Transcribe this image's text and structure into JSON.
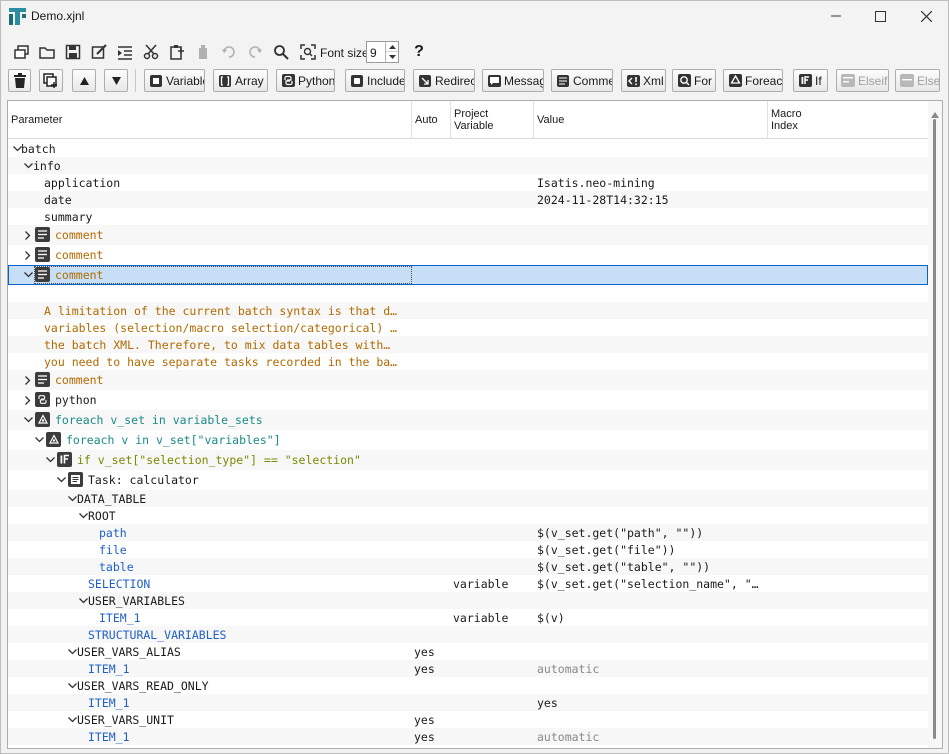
{
  "window": {
    "title": "Demo.xjnl",
    "controls": {
      "minimize": "minimize",
      "maximize": "maximize",
      "close": "close"
    }
  },
  "toolbar_top": {
    "icons": [
      "new-window-icon",
      "open-folder-icon",
      "save-icon",
      "edit-check-icon",
      "indent-icon",
      "cut-icon",
      "paste-insert-icon",
      "clipboard-icon",
      "undo-icon",
      "redo-icon",
      "search-icon",
      "zoom-fit-icon"
    ],
    "font_size_label": "Font size",
    "font_size_value": "9",
    "help_label": "?"
  },
  "toolbar_nodes": {
    "buttons": [
      {
        "label": "Variable",
        "icon": "square-icon"
      },
      {
        "label": "Array",
        "icon": "brackets-icon"
      },
      {
        "label": "Python",
        "icon": "python-icon"
      },
      {
        "label": "Include",
        "icon": "include-icon"
      },
      {
        "label": "Redirect",
        "icon": "redirect-icon"
      },
      {
        "label": "Message",
        "icon": "message-icon"
      },
      {
        "label": "Comment",
        "icon": "comment-icon"
      },
      {
        "label": "Xml",
        "icon": "xml-icon"
      },
      {
        "label": "For",
        "icon": "for-icon"
      },
      {
        "label": "Foreach",
        "icon": "foreach-icon"
      },
      {
        "label": "If",
        "icon": "if-icon"
      },
      {
        "label": "Elseif",
        "icon": "elseif-icon",
        "disabled": true
      },
      {
        "label": "Else",
        "icon": "else-icon",
        "disabled": true
      }
    ]
  },
  "columns": {
    "parameter": "Parameter",
    "auto": "Auto",
    "project_variable_line1": "Project",
    "project_variable_line2": "Variable",
    "value": "Value",
    "macro_index_line1": "Macro",
    "macro_index_line2": "Index"
  },
  "rows": [
    {
      "label": "batch",
      "color": "black",
      "auto": "",
      "pv": "",
      "value": ""
    },
    {
      "label": "info",
      "color": "black",
      "auto": "",
      "pv": "",
      "value": ""
    },
    {
      "label": "application",
      "color": "black",
      "auto": "",
      "pv": "",
      "value": "Isatis.neo-mining"
    },
    {
      "label": "date",
      "color": "black",
      "auto": "",
      "pv": "",
      "value": "2024-11-28T14:32:15"
    },
    {
      "label": "summary",
      "color": "black",
      "auto": "",
      "pv": "",
      "value": ""
    },
    {
      "label": "comment",
      "color": "orange",
      "auto": "",
      "pv": "",
      "value": ""
    },
    {
      "label": "comment",
      "color": "orange",
      "auto": "",
      "pv": "",
      "value": ""
    },
    {
      "label": "comment",
      "color": "orange",
      "auto": "",
      "pv": "",
      "value": ""
    },
    {
      "label": "",
      "color": "orange",
      "auto": "",
      "pv": "",
      "value": ""
    },
    {
      "label": "A limitation of the current batch syntax is that d…",
      "color": "orange",
      "auto": "",
      "pv": "",
      "value": ""
    },
    {
      "label": "variables (selection/macro selection/categorical) …",
      "color": "orange",
      "auto": "",
      "pv": "",
      "value": ""
    },
    {
      "label": "the batch XML.  Therefore, to mix data tables with…",
      "color": "orange",
      "auto": "",
      "pv": "",
      "value": ""
    },
    {
      "label": "you need to have separate tasks recorded in the ba…",
      "color": "orange",
      "auto": "",
      "pv": "",
      "value": ""
    },
    {
      "label": "comment",
      "color": "orange",
      "auto": "",
      "pv": "",
      "value": ""
    },
    {
      "label": "python",
      "color": "black",
      "auto": "",
      "pv": "",
      "value": ""
    },
    {
      "label": "foreach v_set in variable_sets",
      "color": "teal",
      "auto": "",
      "pv": "",
      "value": ""
    },
    {
      "label": "foreach v in v_set[\"variables\"]",
      "color": "teal",
      "auto": "",
      "pv": "",
      "value": ""
    },
    {
      "label": "if v_set[\"selection_type\"] == \"selection\"",
      "color": "olive",
      "auto": "",
      "pv": "",
      "value": ""
    },
    {
      "label": "Task: calculator",
      "color": "black",
      "auto": "",
      "pv": "",
      "value": ""
    },
    {
      "label": "DATA_TABLE",
      "color": "black",
      "auto": "",
      "pv": "",
      "value": ""
    },
    {
      "label": "ROOT",
      "color": "black",
      "auto": "",
      "pv": "",
      "value": ""
    },
    {
      "label": "path",
      "color": "blue",
      "auto": "",
      "pv": "",
      "value": "$(v_set.get(\"path\", \"\"))"
    },
    {
      "label": "file",
      "color": "blue",
      "auto": "",
      "pv": "",
      "value": "$(v_set.get(\"file\"))"
    },
    {
      "label": "table",
      "color": "blue",
      "auto": "",
      "pv": "",
      "value": "$(v_set.get(\"table\", \"\"))"
    },
    {
      "label": "SELECTION",
      "color": "blue",
      "auto": "",
      "pv": "variable",
      "value": "$(v_set.get(\"selection_name\", \"…"
    },
    {
      "label": "USER_VARIABLES",
      "color": "black",
      "auto": "",
      "pv": "",
      "value": ""
    },
    {
      "label": "ITEM_1",
      "color": "blue",
      "auto": "",
      "pv": "variable",
      "value": "$(v)"
    },
    {
      "label": "STRUCTURAL_VARIABLES",
      "color": "blue",
      "auto": "",
      "pv": "",
      "value": ""
    },
    {
      "label": "USER_VARS_ALIAS",
      "color": "black",
      "auto": "yes",
      "pv": "",
      "value": ""
    },
    {
      "label": "ITEM_1",
      "color": "blue",
      "auto": "yes",
      "pv": "",
      "value": "automatic",
      "value_color": "grey"
    },
    {
      "label": "USER_VARS_READ_ONLY",
      "color": "black",
      "auto": "",
      "pv": "",
      "value": ""
    },
    {
      "label": "ITEM_1",
      "color": "blue",
      "auto": "",
      "pv": "",
      "value": "yes"
    },
    {
      "label": "USER_VARS_UNIT",
      "color": "black",
      "auto": "yes",
      "pv": "",
      "value": ""
    },
    {
      "label": "ITEM_1",
      "color": "blue",
      "auto": "yes",
      "pv": "",
      "value": "automatic",
      "value_color": "grey"
    }
  ]
}
